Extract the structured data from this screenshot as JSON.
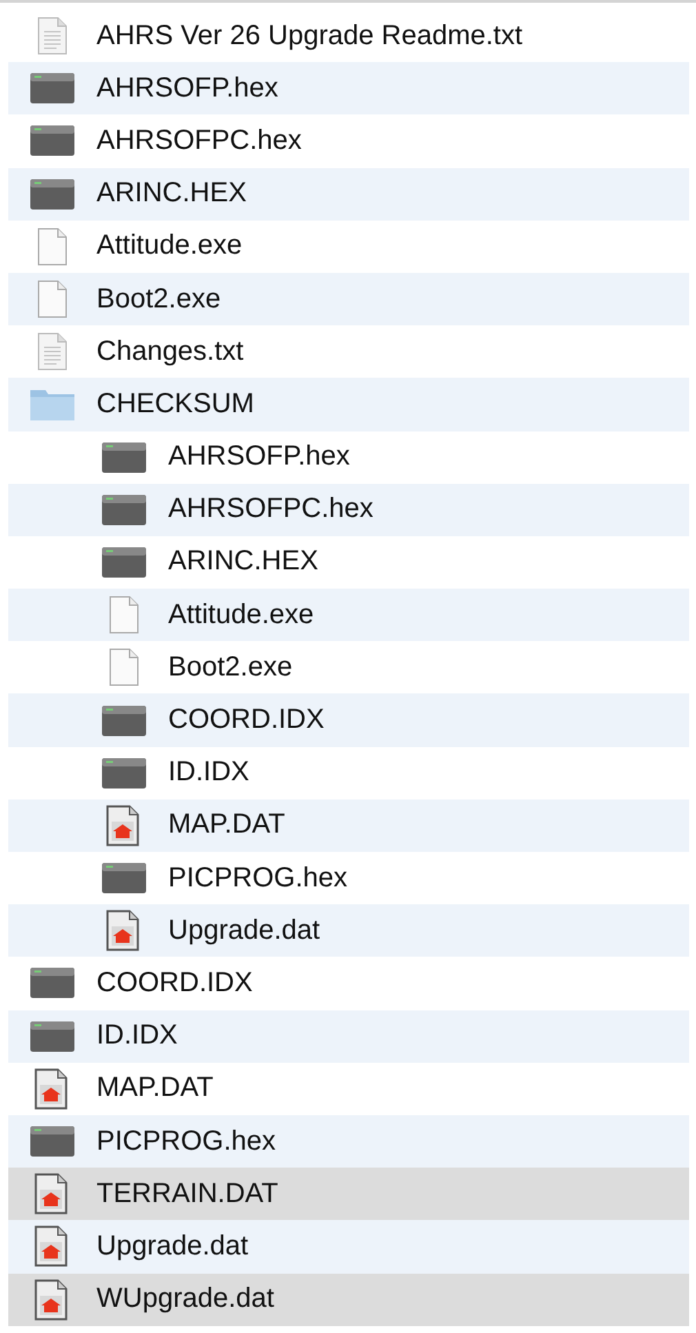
{
  "files": [
    {
      "name": "AHRS Ver 26 Upgrade Readme.txt",
      "kind": "text",
      "selected": false
    },
    {
      "name": "AHRSOFP.hex",
      "kind": "binary",
      "selected": false
    },
    {
      "name": "AHRSOFPC.hex",
      "kind": "binary",
      "selected": false
    },
    {
      "name": "ARINC.HEX",
      "kind": "binary",
      "selected": false
    },
    {
      "name": "Attitude.exe",
      "kind": "blank",
      "selected": false
    },
    {
      "name": "Boot2.exe",
      "kind": "blank",
      "selected": false
    },
    {
      "name": "Changes.txt",
      "kind": "text",
      "selected": false
    },
    {
      "name": "CHECKSUM",
      "kind": "folder",
      "selected": false,
      "children": [
        {
          "name": "AHRSOFP.hex",
          "kind": "binary",
          "selected": false
        },
        {
          "name": "AHRSOFPC.hex",
          "kind": "binary",
          "selected": false
        },
        {
          "name": "ARINC.HEX",
          "kind": "binary",
          "selected": false
        },
        {
          "name": "Attitude.exe",
          "kind": "blank",
          "selected": false
        },
        {
          "name": "Boot2.exe",
          "kind": "blank",
          "selected": false
        },
        {
          "name": "COORD.IDX",
          "kind": "binary",
          "selected": false
        },
        {
          "name": "ID.IDX",
          "kind": "binary",
          "selected": false
        },
        {
          "name": "MAP.DAT",
          "kind": "image",
          "selected": false
        },
        {
          "name": "PICPROG.hex",
          "kind": "binary",
          "selected": false
        },
        {
          "name": "Upgrade.dat",
          "kind": "image",
          "selected": false
        }
      ]
    },
    {
      "name": "COORD.IDX",
      "kind": "binary",
      "selected": false
    },
    {
      "name": "ID.IDX",
      "kind": "binary",
      "selected": false
    },
    {
      "name": "MAP.DAT",
      "kind": "image",
      "selected": false
    },
    {
      "name": "PICPROG.hex",
      "kind": "binary",
      "selected": false
    },
    {
      "name": "TERRAIN.DAT",
      "kind": "image",
      "selected": true
    },
    {
      "name": "Upgrade.dat",
      "kind": "image",
      "selected": false
    },
    {
      "name": "WUpgrade.dat",
      "kind": "image",
      "selected": true
    }
  ]
}
